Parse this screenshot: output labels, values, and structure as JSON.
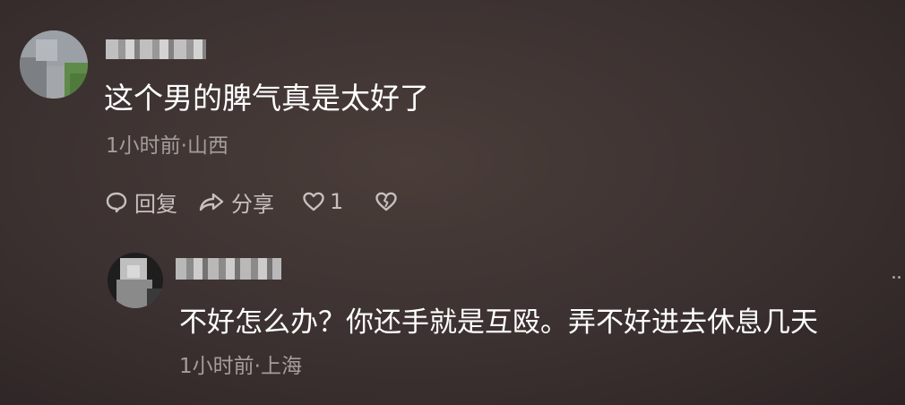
{
  "comments": [
    {
      "text": "这个男的脾气真是太好了",
      "meta": "1小时前·山西",
      "actions": {
        "reply_label": "回复",
        "share_label": "分享",
        "like_count": "1"
      }
    },
    {
      "text": "不好怎么办？你还手就是互殴。弄不好进去休息几天",
      "meta": "1小时前·上海"
    }
  ],
  "icons": {
    "reply": "comment-bubble-icon",
    "share": "share-arrow-icon",
    "like": "heart-icon",
    "dislike": "broken-heart-icon",
    "more": "more-dots-icon"
  },
  "colors": {
    "background": "#3b3130",
    "primary_text": "#ffffff",
    "secondary_text": "#a49d9b",
    "action_text": "#c7c0be"
  }
}
